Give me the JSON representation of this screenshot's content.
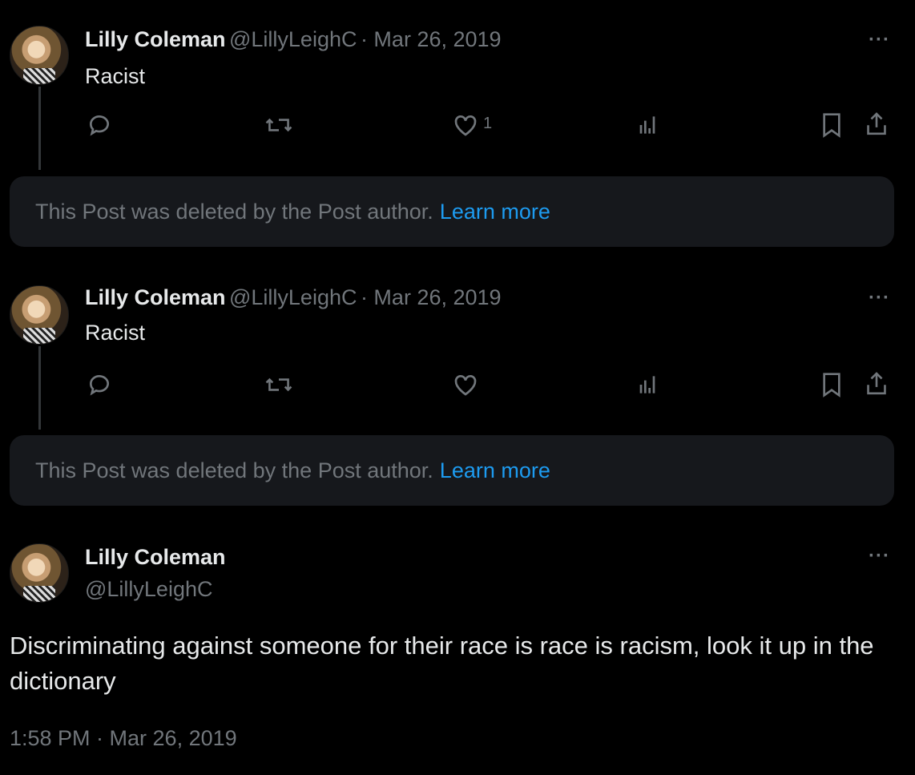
{
  "tweets": [
    {
      "name": "Lilly Coleman",
      "handle": "@LillyLeighC",
      "date": "· Mar 26, 2019",
      "text": "Racist",
      "like_count": "1"
    },
    {
      "name": "Lilly Coleman",
      "handle": "@LillyLeighC",
      "date": "· Mar 26, 2019",
      "text": "Racist",
      "like_count": ""
    }
  ],
  "deleted_notice": {
    "text": "This Post was deleted by the Post author.",
    "link": "Learn more"
  },
  "main_tweet": {
    "name": "Lilly Coleman",
    "handle": "@LillyLeighC",
    "text": "Discriminating against someone for their race is race is racism, look it up in the dictionary",
    "timestamp": "1:58 PM · Mar 26, 2019"
  },
  "more_label": "···",
  "icons": [
    "reply-icon",
    "retweet-icon",
    "like-icon",
    "views-icon",
    "bookmark-icon",
    "share-icon",
    "more-icon"
  ],
  "colors": {
    "background": "#000000",
    "text": "#e7e9ea",
    "muted": "#71767b",
    "link": "#1d9bf0",
    "notice_bg": "#16181c"
  }
}
